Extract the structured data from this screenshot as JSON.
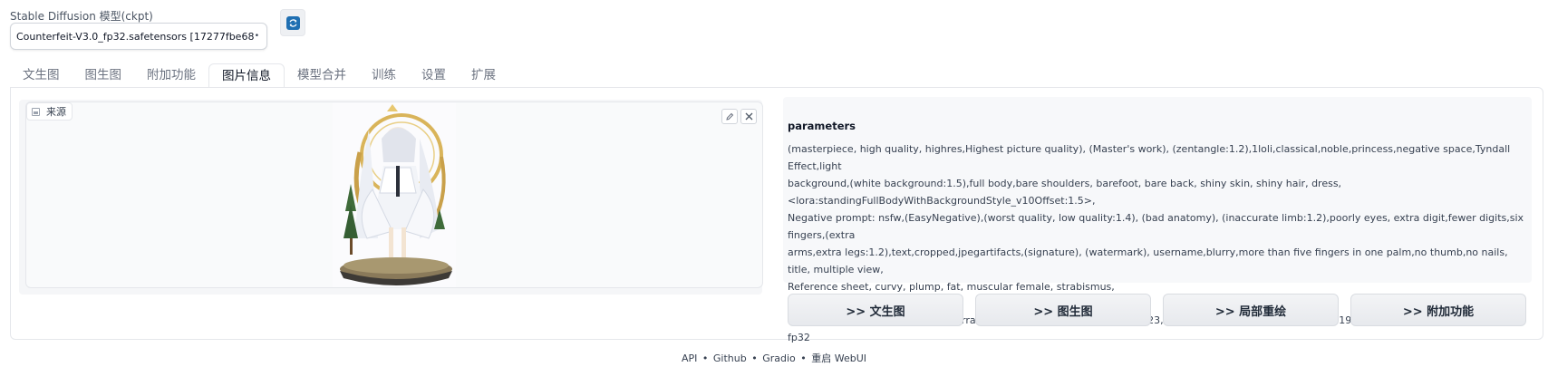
{
  "model": {
    "label": "Stable Diffusion 模型(ckpt)",
    "selected": "Counterfeit-V3.0_fp32.safetensors [17277fbe68]"
  },
  "tabs": [
    {
      "label": "文生图",
      "active": false
    },
    {
      "label": "图生图",
      "active": false
    },
    {
      "label": "附加功能",
      "active": false
    },
    {
      "label": "图片信息",
      "active": true
    },
    {
      "label": "模型合并",
      "active": false
    },
    {
      "label": "训练",
      "active": false
    },
    {
      "label": "设置",
      "active": false
    },
    {
      "label": "扩展",
      "active": false
    }
  ],
  "image_panel": {
    "source_label": "来源",
    "edit_icon": "pencil-icon",
    "close_icon": "close-icon"
  },
  "info": {
    "title": "parameters",
    "prompt_line1": "(masterpiece, high quality, highres,Highest picture quality), (Master's work), (zentangle:1.2),1loli,classical,noble,princess,negative space,Tyndall Effect,light",
    "prompt_line2": "background,(white background:1.5),full body,bare shoulders, barefoot, bare back, shiny skin, shiny hair, dress,",
    "prompt_line3": "<lora:standingFullBodyWithBackgroundStyle_v10Offset:1.5>,",
    "negative_line1": "Negative prompt: nsfw,(EasyNegative),(worst quality, low quality:1.4), (bad anatomy), (inaccurate limb:1.2),poorly eyes, extra digit,fewer digits,six fingers,(extra",
    "negative_line2": "arms,extra legs:1.2),text,cropped,jpegartifacts,(signature), (watermark), username,blurry,more than five fingers in one palm,no thumb,no nails, title, multiple view,",
    "negative_line3": "Reference sheet, curvy, plump, fat, muscular female, strabismus,",
    "settings": "Steps: 20, Sampler: DPM++ 2M Karras, CFG scale: 7.5, Seed: 8353457623, Size: 512x768, Model hash: 1d10a19f06, Model: anything-v4.5-pruned-fp32"
  },
  "buttons": {
    "txt2img": ">> 文生图",
    "img2img": ">> 图生图",
    "inpaint": ">> 局部重绘",
    "extras": ">> 附加功能"
  },
  "footer": {
    "api": "API",
    "github": "Github",
    "gradio": "Gradio",
    "reload": "重启 WebUI",
    "sep": "•"
  },
  "colors": {
    "accent": "#1f6fb2",
    "panel_bg": "#f7f8fa",
    "border": "#e5e7eb"
  }
}
